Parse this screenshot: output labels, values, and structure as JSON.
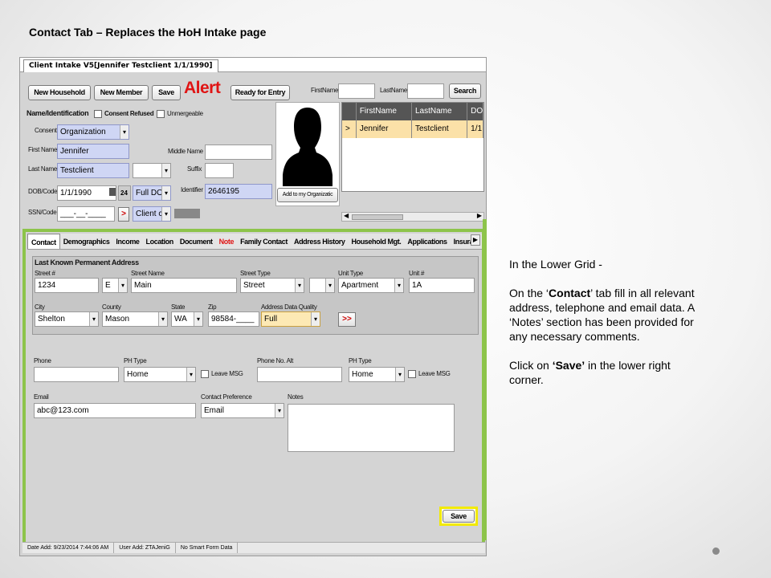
{
  "slide": {
    "title": "Contact  Tab – Replaces the HoH Intake page"
  },
  "window": {
    "tab_title": "Client Intake V5[Jennifer Testclient 1/1/1990]"
  },
  "toolbar": {
    "new_household": "New Household",
    "new_member": "New Member",
    "save": "Save",
    "alert": "Alert",
    "ready_for_entry": "Ready for Entry",
    "firstname_label": "FirstName",
    "lastname_label": "LastName",
    "search": "Search"
  },
  "identification": {
    "section": "Name/Identification",
    "consent_refused": "Consent Refused",
    "unmergeable": "Unmergeable",
    "consent_label": "Consent",
    "consent_value": "Organization",
    "first_name_label": "First Name",
    "first_name_value": "Jennifer",
    "middle_name_label": "Middle Name",
    "last_name_label": "Last Name",
    "last_name_value": "Testclient",
    "suffix_label": "Suffix",
    "dob_label": "DOB/Code",
    "dob_value": "1/1/1990",
    "dob_code_num": "24",
    "dob_code_value": "Full DO",
    "identifier_label": "Identifier",
    "identifier_value": "2646195",
    "ssn_label": "SSN/Code",
    "ssn_value": "___-__-____",
    "ssn_arrow": ">",
    "ssn_code_value": "Client c",
    "add_to_org": "Add to my Organizatic"
  },
  "search_grid": {
    "columns": [
      "FirstName",
      "LastName",
      "DO"
    ],
    "rows": [
      {
        "arrow": ">",
        "first": "Jennifer",
        "last": "Testclient",
        "dob": "1/1"
      }
    ],
    "scroll_left": "◀",
    "scroll_right": "▶"
  },
  "tabs": [
    "Contact",
    "Demographics",
    "Income",
    "Location",
    "Document",
    "Note",
    "Family Contact",
    "Address History",
    "Household Mgt.",
    "Applications",
    "Insura"
  ],
  "tab_next": "▶",
  "address": {
    "section": "Last Known Permanent Address",
    "street_no_label": "Street #",
    "street_no": "1234",
    "direction": "E",
    "street_name_label": "Street Name",
    "street_name": "Main",
    "street_type_label": "Street Type",
    "street_type": "Street",
    "unit_type_label": "Unit Type",
    "unit_type": "Apartment",
    "unit_no_label": "Unit #",
    "unit_no": "1A",
    "city_label": "City",
    "city": "Shelton",
    "county_label": "County",
    "county": "Mason",
    "state_label": "State",
    "state": "WA",
    "zip_label": "Zip",
    "zip": "98584-____",
    "quality_label": "Address Data Quality",
    "quality": "Full",
    "more": ">>"
  },
  "contact": {
    "phone_label": "Phone",
    "ph_type_label": "PH Type",
    "ph_type": "Home",
    "leave_msg": "Leave MSG",
    "phone_alt_label": "Phone No. Alt",
    "ph_type2_label": "PH Type",
    "ph_type2": "Home",
    "leave_msg2": "Leave MSG",
    "email_label": "Email",
    "email": "abc@123.com",
    "contact_pref_label": "Contact Preference",
    "contact_pref": "Email",
    "notes_label": "Notes",
    "save": "Save"
  },
  "status": {
    "date_add": "Date Add: 9/23/2014 7:44:06 AM",
    "user_add": "User Add: ZTAJeniG",
    "smart_form": "No Smart Form Data"
  },
  "instructions": {
    "p1": "In the Lower Grid -",
    "p2_pre": "On the ‘",
    "p2_bold": "Contact",
    "p2_post": "’ tab fill in all relevant address, telephone and email data. A ‘Notes’ section has been provided for any necessary comments.",
    "p3_pre": "Click on ",
    "p3_bold": "‘Save’",
    "p3_post": " in the lower right corner."
  }
}
